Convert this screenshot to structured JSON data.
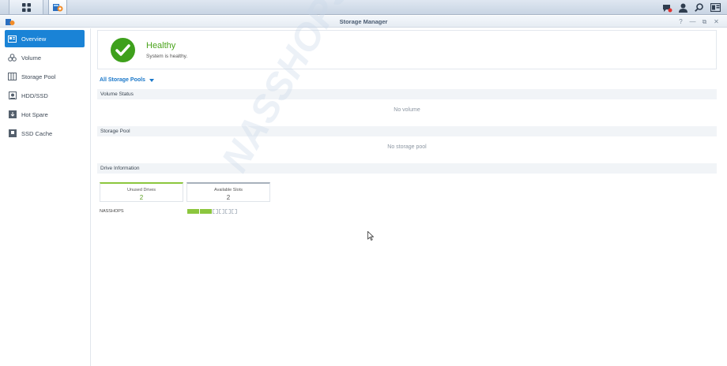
{
  "taskbar": {
    "main_menu_icon": "grid-icon",
    "active_app_icon": "storage-manager-icon",
    "right_icons": [
      "notification-icon",
      "user-icon",
      "search-icon",
      "widgets-icon"
    ]
  },
  "window": {
    "title": "Storage Manager",
    "controls": [
      "help-icon",
      "minimize-icon",
      "maximize-icon",
      "close-icon"
    ],
    "help_glyph": "?",
    "minimize_glyph": "—",
    "maximize_glyph": "⧉",
    "close_glyph": "✕"
  },
  "sidebar": {
    "items": [
      {
        "label": "Overview",
        "icon": "overview-icon",
        "active": true
      },
      {
        "label": "Volume",
        "icon": "volume-icon",
        "active": false
      },
      {
        "label": "Storage Pool",
        "icon": "storage-pool-icon",
        "active": false
      },
      {
        "label": "HDD/SSD",
        "icon": "hdd-icon",
        "active": false
      },
      {
        "label": "Hot Spare",
        "icon": "hot-spare-icon",
        "active": false
      },
      {
        "label": "SSD Cache",
        "icon": "ssd-cache-icon",
        "active": false
      }
    ]
  },
  "health": {
    "status": "Healthy",
    "message": "System is healthy.",
    "color": "#4aa31b"
  },
  "pool_filter": {
    "selected": "All Storage Pools"
  },
  "sections": {
    "volume_status": {
      "title": "Volume Status",
      "empty": "No volume"
    },
    "storage_pool": {
      "title": "Storage Pool",
      "empty": "No storage pool"
    },
    "drive_info": {
      "title": "Drive Information"
    }
  },
  "drives": {
    "unused_label": "Unused Drives",
    "unused_count": "2",
    "available_label": "Available Slots",
    "available_count": "2",
    "nas_name": "NASSHOPS",
    "slots_used": 2,
    "slots_total": 6
  },
  "watermark": "NASSHOPS.net",
  "colors": {
    "accent": "#1a83d6",
    "healthy": "#4aa31b",
    "drive_used": "#8cc63e"
  }
}
